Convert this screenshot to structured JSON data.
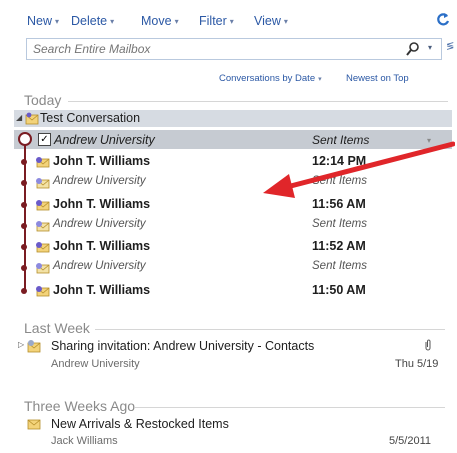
{
  "toolbar": {
    "items": [
      {
        "label": "New"
      },
      {
        "label": "Delete"
      },
      {
        "label": "Move"
      },
      {
        "label": "Filter"
      },
      {
        "label": "View"
      }
    ]
  },
  "search": {
    "placeholder": "Search Entire Mailbox"
  },
  "sort": {
    "by_label": "Conversations by Date",
    "order_label": "Newest on Top"
  },
  "groups": [
    {
      "label": "Today"
    },
    {
      "label": "Last Week"
    },
    {
      "label": "Three Weeks Ago"
    }
  ],
  "conversation": {
    "title": "Test Conversation",
    "selected": {
      "sender": "Andrew University",
      "folder": "Sent Items"
    },
    "messages": [
      {
        "sender": "John T. Williams",
        "time": "12:14 PM"
      },
      {
        "sender": "Andrew University",
        "time": "Sent Items"
      },
      {
        "sender": "John T. Williams",
        "time": "11:56 AM"
      },
      {
        "sender": "Andrew University",
        "time": "Sent Items"
      },
      {
        "sender": "John T. Williams",
        "time": "11:52 AM"
      },
      {
        "sender": "Andrew University",
        "time": "Sent Items"
      },
      {
        "sender": "John T. Williams",
        "time": "11:50 AM"
      }
    ]
  },
  "last_week_item": {
    "title": "Sharing invitation: Andrew University - Contacts",
    "from": "Andrew University",
    "date": "Thu 5/19"
  },
  "three_weeks_item": {
    "title": "New Arrivals & Restocked Items",
    "from": "Jack Williams",
    "date": "5/5/2011"
  },
  "colors": {
    "link": "#2b58a5",
    "thread": "#7a1c22",
    "arrow": "#e0262a",
    "selection": "#c6cbd2"
  }
}
